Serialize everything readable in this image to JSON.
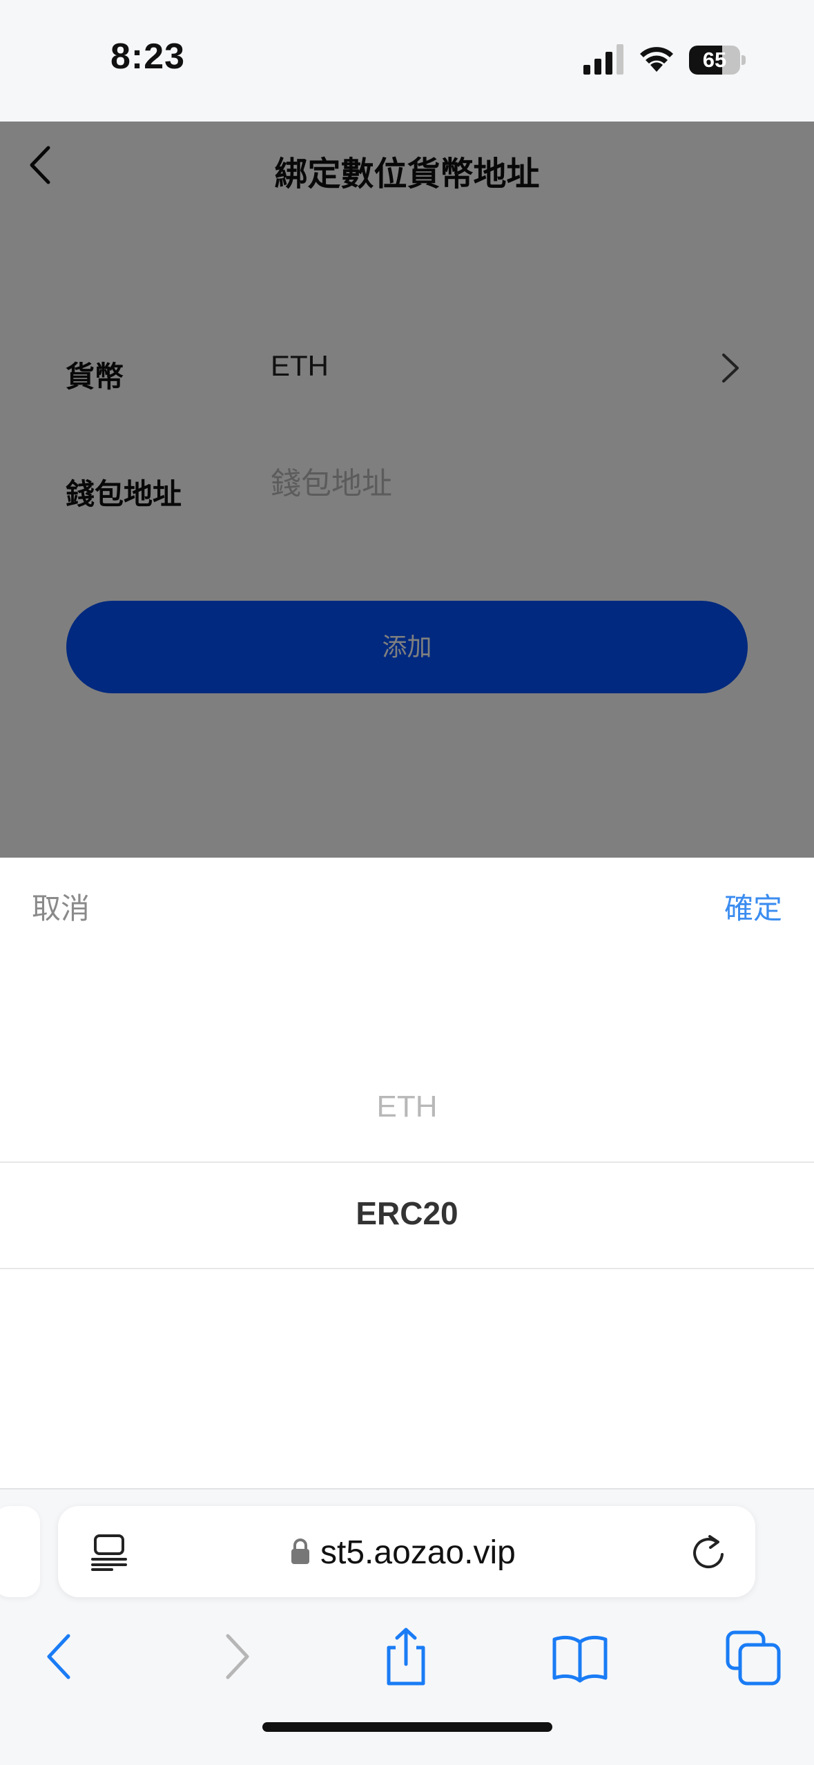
{
  "status_bar": {
    "time": "8:23",
    "battery_level": "65",
    "battery_fraction": 0.65
  },
  "page": {
    "title": "綁定數位貨幣地址",
    "currency_label": "貨幣",
    "currency_value": "ETH",
    "wallet_label": "錢包地址",
    "wallet_placeholder": "錢包地址",
    "wallet_value": "",
    "add_button": "添加",
    "accent_color": "#0052ff"
  },
  "picker": {
    "cancel": "取消",
    "confirm": "確定",
    "options": [
      "ETH",
      "ERC20"
    ],
    "selected": "ERC20",
    "confirm_color": "#3b8cf0"
  },
  "browser": {
    "url": "st5.aozao.vip",
    "icons": [
      "reader-icon",
      "lock-icon",
      "reload-icon",
      "back-icon",
      "forward-icon",
      "share-icon",
      "bookmarks-icon",
      "tabs-icon"
    ]
  }
}
